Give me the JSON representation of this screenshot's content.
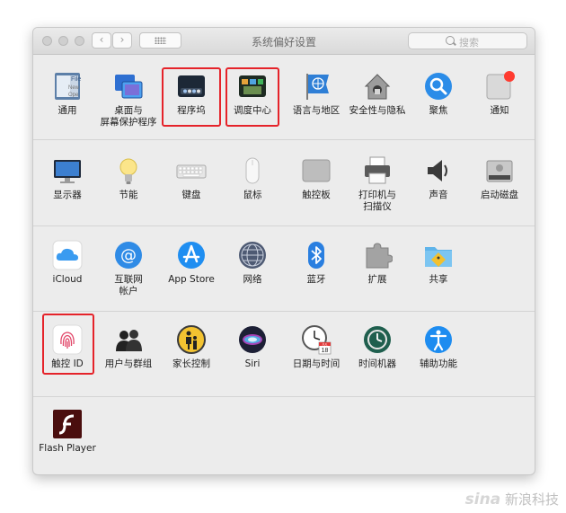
{
  "window": {
    "title": "系统偏好设置",
    "search_placeholder": "搜索"
  },
  "nav": {
    "back": "‹",
    "forward": "›"
  },
  "watermark": {
    "brand": "sina",
    "text": "新浪科技"
  },
  "rows": [
    {
      "items": [
        {
          "id": "general",
          "label": "通用"
        },
        {
          "id": "desktop",
          "label": "桌面与",
          "label2": "屏幕保护程序"
        },
        {
          "id": "dock",
          "label": "程序坞"
        },
        {
          "id": "mission",
          "label": "调度中心"
        },
        {
          "id": "language",
          "label": "语言与地区"
        },
        {
          "id": "security",
          "label": "安全性与隐私"
        },
        {
          "id": "spotlight",
          "label": "聚焦"
        },
        {
          "id": "notifications",
          "label": "通知"
        }
      ]
    },
    {
      "items": [
        {
          "id": "displays",
          "label": "显示器"
        },
        {
          "id": "energy",
          "label": "节能"
        },
        {
          "id": "keyboard",
          "label": "键盘"
        },
        {
          "id": "mouse",
          "label": "鼠标"
        },
        {
          "id": "trackpad",
          "label": "触控板"
        },
        {
          "id": "printers",
          "label": "打印机与",
          "label2": "扫描仪"
        },
        {
          "id": "sound",
          "label": "声音"
        },
        {
          "id": "startup",
          "label": "启动磁盘"
        }
      ]
    },
    {
      "items": [
        {
          "id": "icloud",
          "label": "iCloud"
        },
        {
          "id": "internet",
          "label": "互联网",
          "label2": "帐户"
        },
        {
          "id": "appstore",
          "label": "App Store"
        },
        {
          "id": "network",
          "label": "网络"
        },
        {
          "id": "bluetooth",
          "label": "蓝牙"
        },
        {
          "id": "extensions",
          "label": "扩展"
        },
        {
          "id": "sharing",
          "label": "共享"
        }
      ]
    },
    {
      "items": [
        {
          "id": "touchid",
          "label": "触控 ID"
        },
        {
          "id": "users",
          "label": "用户与群组"
        },
        {
          "id": "parental",
          "label": "家长控制"
        },
        {
          "id": "siri",
          "label": "Siri"
        },
        {
          "id": "datetime",
          "label": "日期与时间"
        },
        {
          "id": "timemachine",
          "label": "时间机器"
        },
        {
          "id": "accessibility",
          "label": "辅助功能"
        }
      ]
    },
    {
      "items": [
        {
          "id": "flash",
          "label": "Flash Player"
        }
      ]
    }
  ],
  "icon_text": {
    "general_file": "File",
    "general_new": "New",
    "general_ope": "Ope",
    "calendar_month": "JUL",
    "calendar_day": "18"
  },
  "highlighted": [
    "dock",
    "mission",
    "touchid"
  ],
  "colors": {
    "highlight": "#e5232a",
    "notification_badge": "#ff3b30"
  }
}
